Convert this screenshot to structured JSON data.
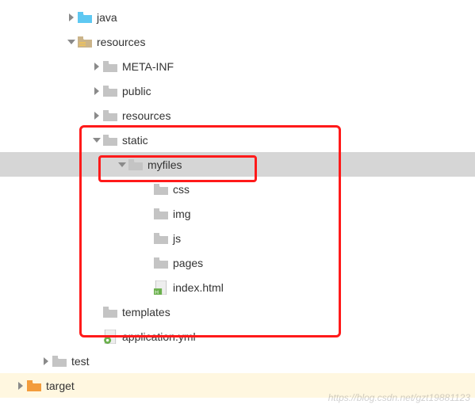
{
  "tree": {
    "java": "java",
    "resources": "resources",
    "meta_inf": "META-INF",
    "public": "public",
    "resources2": "resources",
    "static": "static",
    "myfiles": "myfiles",
    "css": "css",
    "img": "img",
    "js": "js",
    "pages": "pages",
    "index_html": "index.html",
    "templates": "templates",
    "application_yml": "application.yml",
    "test": "test",
    "target": "target"
  },
  "watermark": "https://blog.csdn.net/gzt19881123"
}
